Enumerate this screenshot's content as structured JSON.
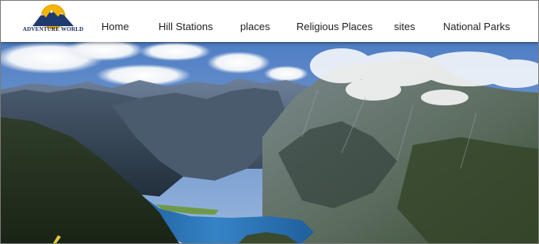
{
  "logo": {
    "text": "ADVENTURE WORLD",
    "icon": "mountain-sun-icon",
    "colors": {
      "sun": "#f4b400",
      "mountains": "#1f3a6e"
    }
  },
  "nav": {
    "items": [
      {
        "label": "Home"
      },
      {
        "label": "Hill Stations"
      },
      {
        "label": "places"
      },
      {
        "label": "Religious Places"
      },
      {
        "label": "sites"
      },
      {
        "label": "National Parks"
      }
    ]
  },
  "hero": {
    "image": "mountain-lake-landscape",
    "colors": {
      "sky": "#6c93cc",
      "lake": "#2f74b5",
      "forest": "#2c3a22"
    }
  }
}
